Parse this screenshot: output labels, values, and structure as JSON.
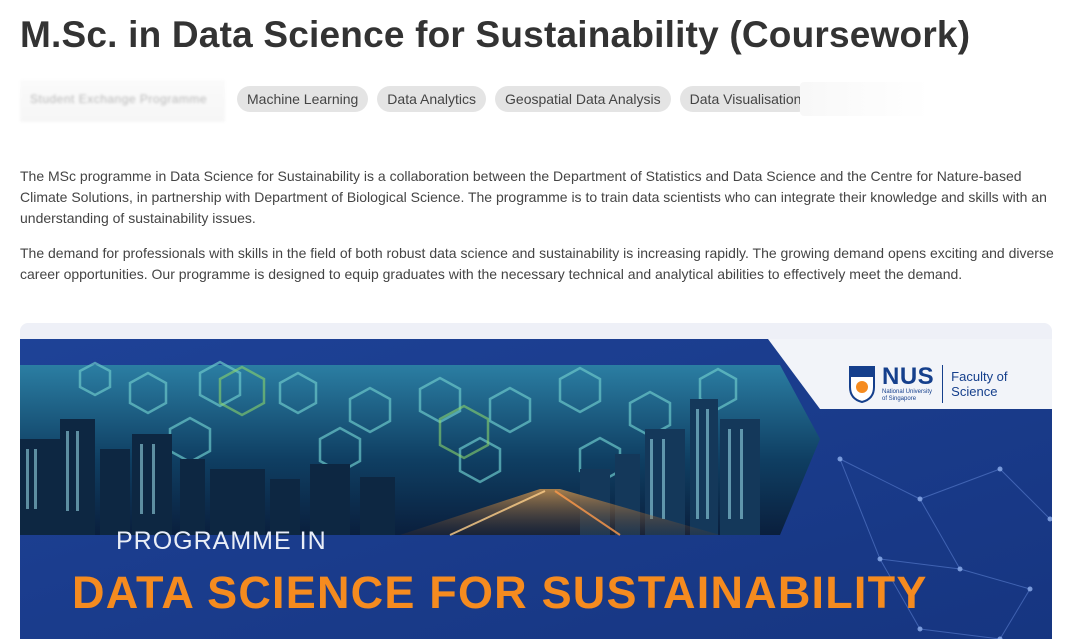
{
  "page": {
    "title": "M.Sc. in Data Science for Sustainability (Coursework)"
  },
  "tags": {
    "blurred_label": "Student Exchange Programme",
    "items": [
      "Machine Learning",
      "Data Analytics",
      "Geospatial Data Analysis",
      "Data Visualisation"
    ]
  },
  "description": {
    "paragraph_1": "The MSc programme in Data Science for Sustainability is a collaboration between the Department of Statistics and Data Science and the Centre for Nature-based Climate Solutions, in partnership with Department of Biological Science. The programme is to train data scientists who can integrate their knowledge and skills with an understanding of sustainability issues.",
    "paragraph_2": "The demand for professionals with skills in the field of both robust data science and sustainability is increasing rapidly. The growing demand opens exciting and diverse career opportunities. Our programme is designed to equip graduates with the necessary technical and analytical abilities to effectively meet the demand."
  },
  "banner": {
    "subtitle": "PROGRAMME IN",
    "title": "DATA SCIENCE FOR SUSTAINABILITY",
    "logo_main": "NUS",
    "logo_small_1": "National University",
    "logo_small_2": "of Singapore",
    "faculty_line_1": "Faculty of",
    "faculty_line_2": "Science"
  },
  "colors": {
    "banner_blue": "#1d3f8f",
    "banner_orange": "#f58b1f",
    "tag_bg": "#e4e4e4",
    "text": "#333333"
  }
}
